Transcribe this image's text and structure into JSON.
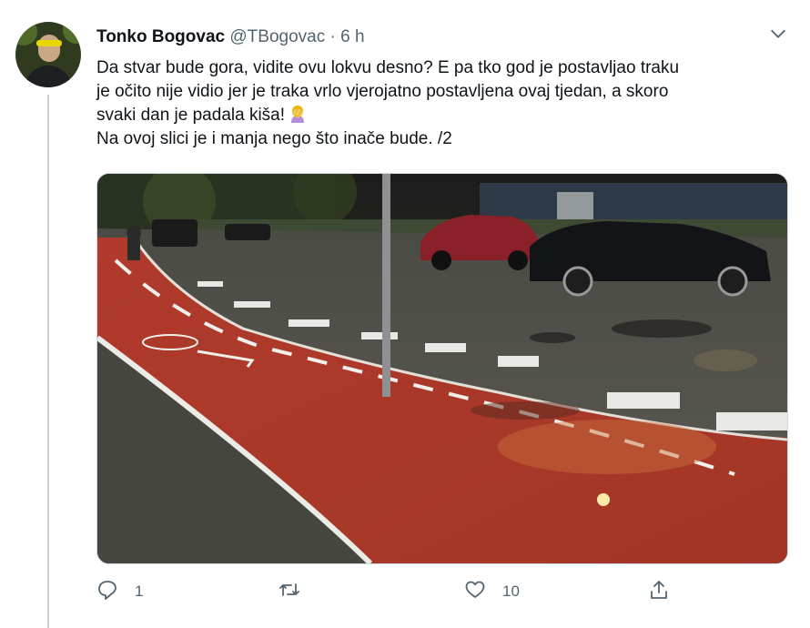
{
  "tweet": {
    "author_name": "Tonko Bogovac",
    "handle": "@TBogovac",
    "separator": "·",
    "time": "6 h",
    "text_lines": [
      "Da stvar bude gora, vidite ovu lokvu desno? E pa tko god je postavljao traku",
      "je očito nije vidio jer je traka vrlo vjerojatno postavljena ovaj tjedan, a skoro",
      "svaki dan je padala kiša! ",
      "Na ovoj slici je i manja nego što inače bude. /2"
    ],
    "emoji": "woman-facepalming-emoji",
    "media": "photo-red-bike-lane-night"
  },
  "actions": {
    "reply": {
      "icon": "reply-icon",
      "count": "1"
    },
    "retweet": {
      "icon": "retweet-icon",
      "count": ""
    },
    "like": {
      "icon": "heart-icon",
      "count": "10"
    },
    "share": {
      "icon": "share-icon",
      "count": ""
    }
  },
  "colors": {
    "icon_gray": "#536471",
    "thread_line": "#c4cfd6",
    "bike_lane": "#b23a2c"
  }
}
